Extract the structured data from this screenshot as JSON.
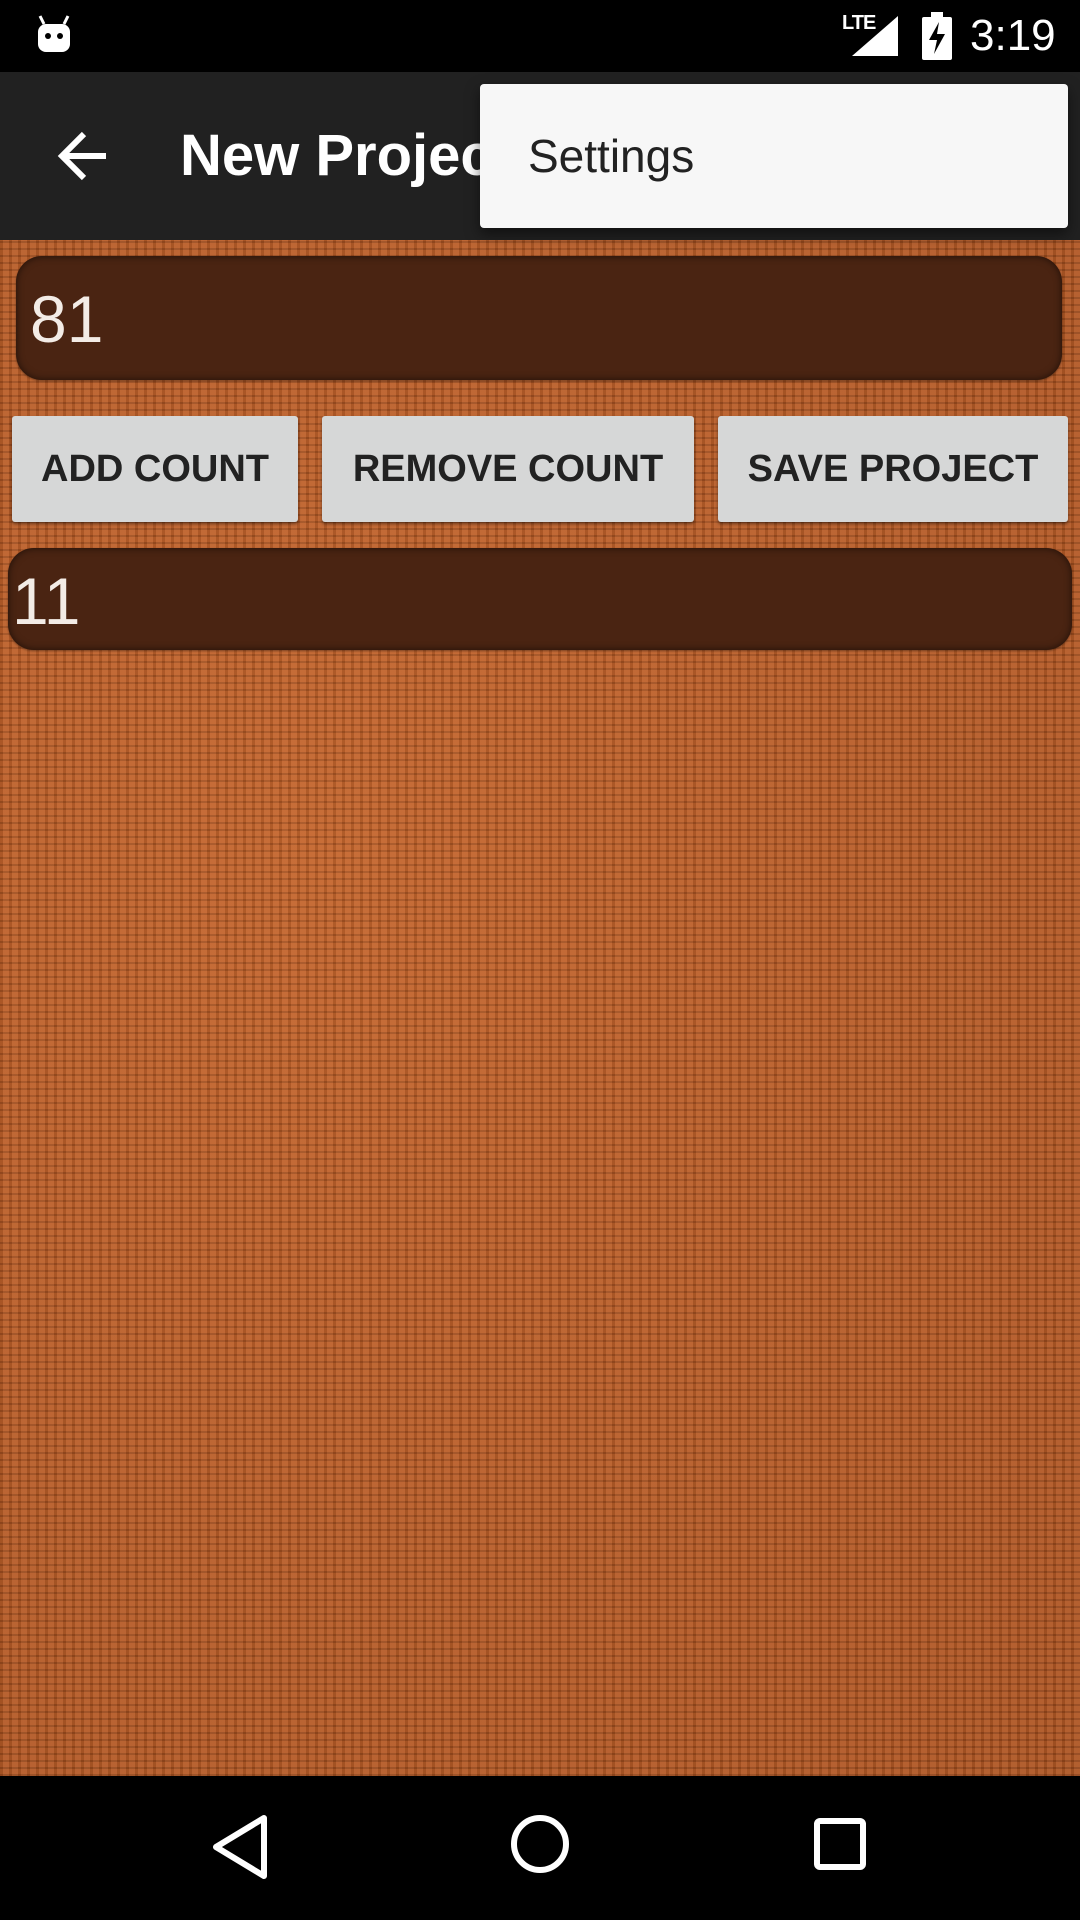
{
  "status_bar": {
    "network": "LTE",
    "time": "3:19",
    "icons": [
      "android-icon",
      "signal-icon",
      "battery-charging-icon"
    ]
  },
  "app_bar": {
    "title": "New Project",
    "back_icon": "arrow-back-icon"
  },
  "overflow_menu": {
    "items": [
      {
        "label": "Settings"
      }
    ]
  },
  "content": {
    "count_value": "81",
    "second_count_value": "11",
    "buttons": {
      "add": "ADD COUNT",
      "remove": "REMOVE COUNT",
      "save": "SAVE PROJECT"
    }
  },
  "nav_bar": {
    "icons": [
      "back-triangle-icon",
      "home-circle-icon",
      "recents-square-icon"
    ]
  },
  "colors": {
    "app_bar": "#212121",
    "field_bg": "#4a2412",
    "background_knit": "#b85a24",
    "button_bg": "#d6d7d7"
  }
}
